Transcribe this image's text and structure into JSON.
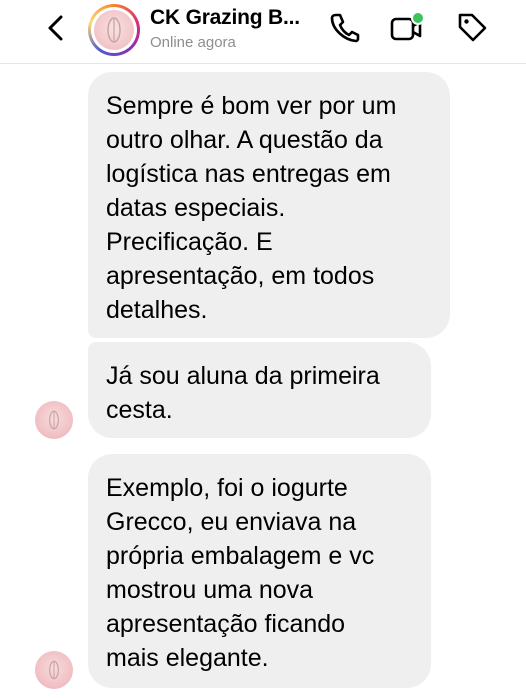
{
  "header": {
    "contact_name": "CK Grazing B...",
    "status": "Online agora",
    "icons": {
      "back": "chevron-left-icon",
      "call": "phone-icon",
      "video": "video-icon",
      "label": "tag-icon"
    },
    "online_dot_color": "#3bc45a"
  },
  "messages": [
    {
      "text": "Sempre é bom ver por um\noutro olhar. A questão da\nlogística nas entregas em\ndatas especiais.\nPrecificação. E\napresentação, em todos\ndetalhes."
    },
    {
      "text": "Já sou aluna da primeira\ncesta."
    },
    {
      "text": "Exemplo, foi o iogurte\nGrecco, eu enviava na\nprópria embalagem e vc\nmostrou uma nova\napresentação ficando\nmais elegante."
    }
  ],
  "colors": {
    "bubble_bg": "#efefef",
    "status_gray": "#8e8e8e"
  }
}
